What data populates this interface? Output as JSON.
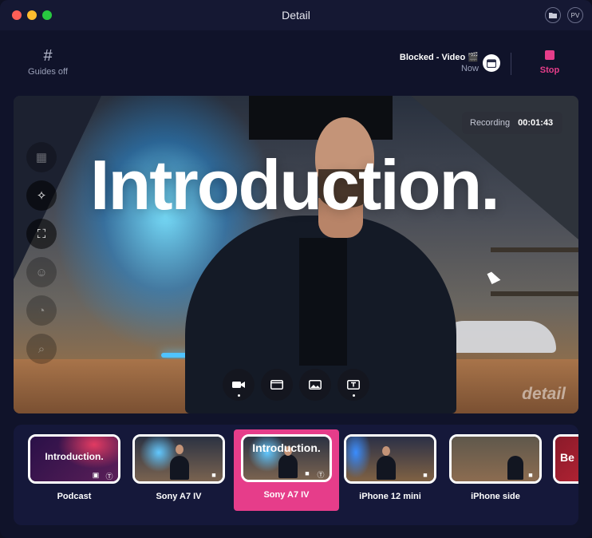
{
  "window": {
    "title": "Detail",
    "folder_icon": "folder-icon",
    "profile_initials": "PV"
  },
  "toolbar": {
    "guides_label": "Guides off",
    "guides_icon": "grid-hash-icon",
    "source_title": "Blocked - Video 🎬",
    "source_subtitle": "Now",
    "source_icon": "calendar-icon",
    "stop_label": "Stop",
    "stop_icon": "stop-square-icon"
  },
  "stage": {
    "title_text": "Introduction.",
    "recording_label": "Recording",
    "recording_time": "00:01:43",
    "watermark": "detail",
    "side_tools": [
      "blur-icon",
      "magic-wand-icon",
      "frame-focus-icon",
      "face-frame-icon",
      "timer-icon",
      "zoom-icon"
    ],
    "bottom_tools": [
      "camera-icon",
      "window-icon",
      "image-icon",
      "text-icon"
    ]
  },
  "scenes": [
    {
      "label": "Podcast",
      "thumb_text": "Introduction."
    },
    {
      "label": "Sony A7 IV",
      "thumb_text": ""
    },
    {
      "label": "Sony A7 IV",
      "thumb_text": "Introduction.",
      "active": true
    },
    {
      "label": "iPhone 12 mini",
      "thumb_text": ""
    },
    {
      "label": "iPhone side",
      "thumb_text": ""
    },
    {
      "label": "",
      "thumb_text": "Be"
    }
  ],
  "colors": {
    "accent": "#e63d8a",
    "background": "#10132a",
    "panel": "#15183a"
  }
}
